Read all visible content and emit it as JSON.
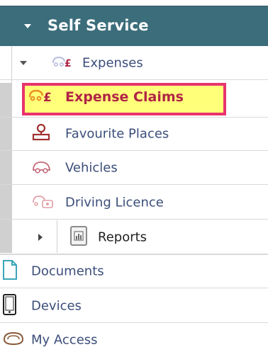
{
  "section": {
    "title": "Self Service",
    "header_color": "#3c6d7b"
  },
  "tree": {
    "expenses": {
      "label": "Expenses",
      "icon": "car-pound-icon"
    },
    "expense_claims": {
      "label": "Expense Claims",
      "icon": "car-pound-icon",
      "highlighted": true
    },
    "favourite_places": {
      "label": "Favourite Places",
      "icon": "map-pin-icon"
    },
    "vehicles": {
      "label": "Vehicles",
      "icon": "car-icon"
    },
    "driving_licence": {
      "label": "Driving Licence",
      "icon": "id-card-icon"
    },
    "reports": {
      "label": "Reports",
      "icon": "report-icon"
    },
    "documents": {
      "label": "Documents",
      "icon": "document-icon"
    },
    "devices": {
      "label": "Devices",
      "icon": "mobile-device-icon"
    },
    "my_access": {
      "label": "My Access",
      "icon": "access-icon"
    }
  },
  "colors": {
    "link_text": "#3b4e7a",
    "highlight_fill": "#ffff7a",
    "highlight_border": "#e8336d"
  }
}
